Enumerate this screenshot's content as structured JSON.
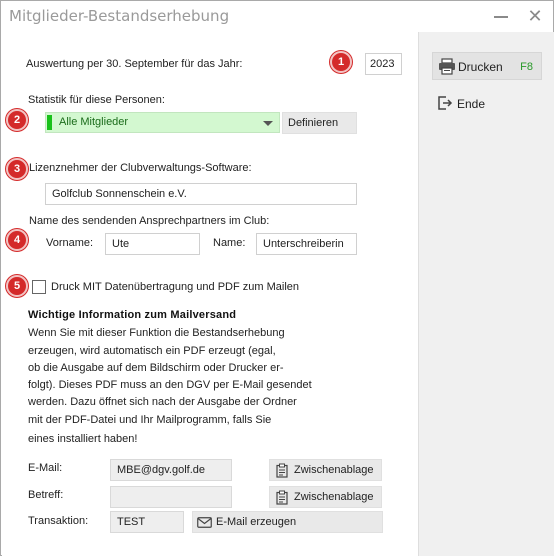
{
  "window": {
    "title": "Mitglieder-Bestandserhebung",
    "minimize_icon": "minimize-icon",
    "close_icon": "close-icon"
  },
  "badges": [
    "1",
    "2",
    "3",
    "4",
    "5"
  ],
  "year_section": {
    "label": "Auswertung per 30. September für das Jahr:",
    "value": "2023"
  },
  "persons_section": {
    "label": "Statistik für diese Personen:",
    "selected": "Alle Mitglieder",
    "define_button": "Definieren"
  },
  "licensee_section": {
    "label": "Lizenznehmer der Clubverwaltungs-Software:",
    "value": "Golfclub Sonnenschein e.V."
  },
  "contact_section": {
    "label": "Name des sendenden Ansprechpartners im Club:",
    "firstname_label": "Vorname:",
    "firstname_value": "Ute",
    "lastname_label": "Name:",
    "lastname_value": "Unterschreiberin"
  },
  "print_option": {
    "label": "Druck MIT Datenübertragung und PDF zum Mailen",
    "checked": false
  },
  "info": {
    "title": "Wichtige Information zum Mailversand",
    "lines": [
      "Wenn Sie mit dieser Funktion die Bestandserhebung",
      "erzeugen, wird automatisch ein PDF erzeugt (egal,",
      "ob die Ausgabe auf dem Bildschirm oder Drucker er-",
      "folgt). Dieses PDF muss an den DGV per E-Mail gesendet",
      "werden. Dazu öffnet sich nach der Ausgabe der Ordner",
      "mit der PDF-Datei und Ihr Mailprogramm, falls Sie",
      "eines installiert haben!"
    ]
  },
  "mail": {
    "email_label": "E-Mail:",
    "email_value": "MBE@dgv.golf.de",
    "clipboard_label": "Zwischenablage",
    "subject_label": "Betreff:",
    "subject_value": "",
    "transaction_label": "Transaktion:",
    "transaction_value": "TEST",
    "create_email_label": "E-Mail erzeugen"
  },
  "sidebar": {
    "print_label": "Drucken",
    "print_key": "F8",
    "exit_label": "Ende"
  },
  "colors": {
    "badge": "#d42a2a",
    "select_bg": "#d3f8d0",
    "select_marker": "#19c11a",
    "shortcut": "#2b9a2b"
  }
}
